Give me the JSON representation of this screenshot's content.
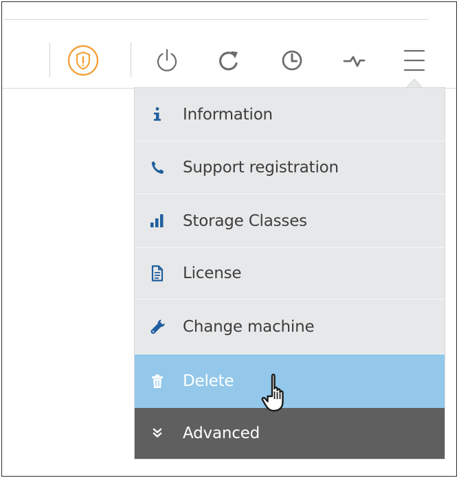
{
  "toolbar": {
    "icons": [
      "shield-warning-icon",
      "power-icon",
      "refresh-icon",
      "clock-icon",
      "activity-icon",
      "hamburger-menu-icon"
    ]
  },
  "menu": {
    "items": [
      {
        "label": "Information",
        "icon": "info-icon"
      },
      {
        "label": "Support registration",
        "icon": "phone-icon"
      },
      {
        "label": "Storage Classes",
        "icon": "bar-chart-icon"
      },
      {
        "label": "License",
        "icon": "document-icon"
      },
      {
        "label": "Change machine",
        "icon": "wrench-icon"
      },
      {
        "label": "Delete",
        "icon": "trash-icon",
        "state": "hovered"
      },
      {
        "label": "Advanced",
        "icon": "double-chevron-down-icon"
      }
    ]
  },
  "colors": {
    "accent": "#f3a13a",
    "icon_gray": "#6c6c6c",
    "menu_bg": "#e7e8e9",
    "hover_bg": "#93c8ea",
    "advanced_bg": "#5f5f5f",
    "text": "#3d3d3d",
    "icon_blue": "#1f5f9f"
  }
}
